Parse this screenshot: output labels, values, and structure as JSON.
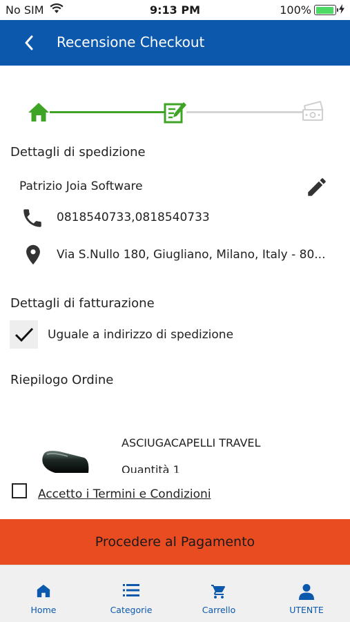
{
  "status_bar": {
    "carrier": "No SIM",
    "time": "9:13 PM",
    "battery": "100%"
  },
  "header": {
    "title": "Recensione Checkout"
  },
  "shipping": {
    "section_title": "Dettagli di spedizione",
    "name": "Patrizio Joia Software",
    "phone": "0818540733,0818540733",
    "address": "Via S.Nullo 180, Giugliano, Milano, Italy - 80..."
  },
  "billing": {
    "section_title": "Dettagli di fatturazione",
    "same_as_shipping_label": "Uguale a indirizzo di spedizione",
    "same_as_shipping_checked": true
  },
  "order_summary": {
    "section_title": "Riepilogo Ordine",
    "items": [
      {
        "name": "ASCIUGACAPELLI TRAVEL",
        "quantity": "Quantità 1"
      }
    ]
  },
  "terms": {
    "label": "Accetto i Termini e Condizioni",
    "checked": false
  },
  "pay_button": {
    "label": "Procedere al Pagamento"
  },
  "colors": {
    "header": "#0b58ad",
    "pay_button": "#ea4c22",
    "step_done": "#3fa326",
    "step_pending": "#d4d4d4"
  },
  "tabs": [
    {
      "label": "Home",
      "icon": "home-icon"
    },
    {
      "label": "Categorie",
      "icon": "list-icon"
    },
    {
      "label": "Carrello",
      "icon": "cart-icon"
    },
    {
      "label": "UTENTE",
      "icon": "user-icon"
    }
  ]
}
